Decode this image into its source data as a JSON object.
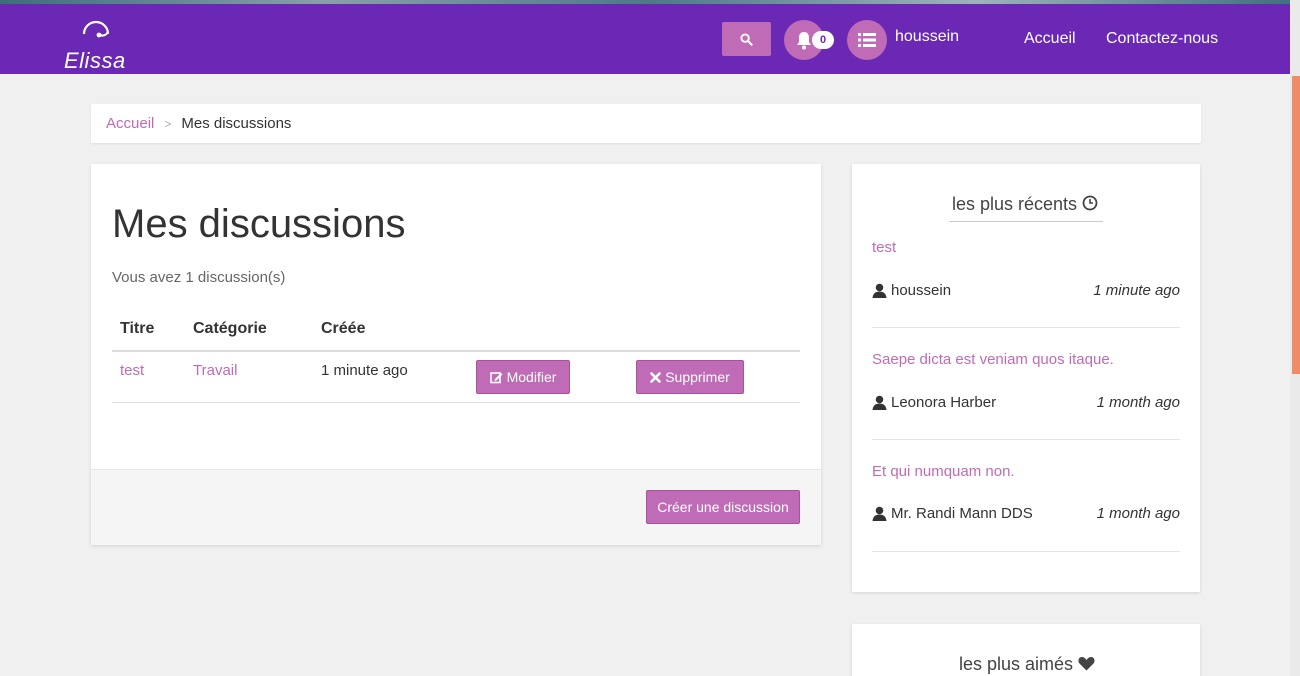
{
  "brand": {
    "name": "Elissa"
  },
  "navbar": {
    "notification_count": "0",
    "username": "houssein",
    "links": [
      "Accueil",
      "Contactez-nous"
    ],
    "bg_color": "#6a28b5",
    "accent_color": "#c06bb6"
  },
  "breadcrumb": {
    "home": "Accueil",
    "separator": ">",
    "current": "Mes discussions"
  },
  "main": {
    "title": "Mes discussions",
    "count_text": "Vous avez 1 discussion(s)",
    "columns": [
      "Titre",
      "Catégorie",
      "Créée"
    ],
    "rows": [
      {
        "title": "test",
        "category": "Travail",
        "created": "1 minute ago",
        "edit_label": "Modifier",
        "delete_label": "Supprimer"
      }
    ],
    "create_label": "Créer une discussion"
  },
  "sidebar": {
    "recent": {
      "title": "les plus récents",
      "items": [
        {
          "title": "test",
          "author": "houssein",
          "time": "1 minute ago"
        },
        {
          "title": "Saepe dicta est veniam quos itaque.",
          "author": "Leonora Harber",
          "time": "1 month ago"
        },
        {
          "title": "Et qui numquam non.",
          "author": "Mr. Randi Mann DDS",
          "time": "1 month ago"
        }
      ]
    },
    "liked": {
      "title": "les plus aimés"
    }
  }
}
